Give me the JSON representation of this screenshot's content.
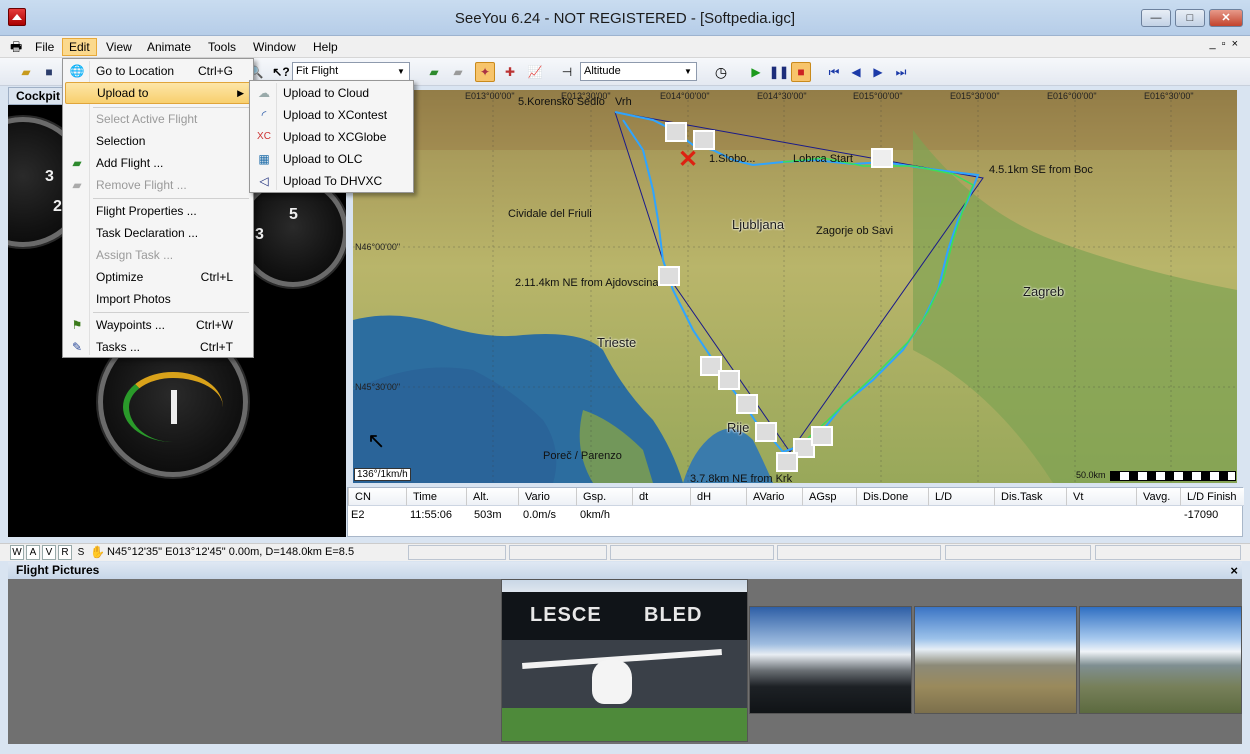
{
  "window": {
    "title": "SeeYou 6.24 - NOT REGISTERED - [Softpedia.igc]",
    "min": "—",
    "max": "□",
    "close": "✕"
  },
  "menubar": [
    "File",
    "Edit",
    "View",
    "Animate",
    "Tools",
    "Window",
    "Help"
  ],
  "mdi": {
    "min": "_",
    "restore": "▫",
    "close": "×"
  },
  "toolbar": {
    "fit_combo": "Fit Flight",
    "altitude_combo": "Altitude"
  },
  "cockpit": {
    "tab": "Cockpit",
    "gauge_numbers": [
      "3",
      "2",
      "3",
      "5"
    ]
  },
  "edit_menu": {
    "items": [
      {
        "label": "Go to Location",
        "shortcut": "Ctrl+G"
      },
      {
        "label": "Upload to",
        "shortcut": ""
      },
      {
        "label": "Select Active Flight",
        "shortcut": ""
      },
      {
        "label": "Selection",
        "shortcut": ""
      },
      {
        "label": "Add Flight ...",
        "shortcut": ""
      },
      {
        "label": "Remove Flight ...",
        "shortcut": ""
      },
      {
        "label": "Flight Properties ...",
        "shortcut": ""
      },
      {
        "label": "Task Declaration ...",
        "shortcut": ""
      },
      {
        "label": "Assign Task ...",
        "shortcut": ""
      },
      {
        "label": "Optimize",
        "shortcut": "Ctrl+L"
      },
      {
        "label": "Import Photos",
        "shortcut": ""
      },
      {
        "label": "Waypoints ...",
        "shortcut": "Ctrl+W"
      },
      {
        "label": "Tasks ...",
        "shortcut": "Ctrl+T"
      }
    ]
  },
  "upload_menu": {
    "items": [
      {
        "label": "Upload to Cloud",
        "icon": "cloud-icon"
      },
      {
        "label": "Upload to XContest",
        "icon": "xcontest-icon"
      },
      {
        "label": "Upload to XCGlobe",
        "icon": "xcglobe-icon"
      },
      {
        "label": "Upload to OLC",
        "icon": "olc-icon"
      },
      {
        "label": "Upload To DHVXC",
        "icon": "dhvxc-icon"
      }
    ]
  },
  "map": {
    "grid_labels": [
      "E013°00'00\"",
      "E013°30'00\"",
      "E014°00'00\"",
      "E014°30'00\"",
      "E015°00'00\"",
      "E015°30'00\"",
      "E016°00'00\"",
      "E016°30'00\"",
      "N46°00'00\"",
      "N45°30'00\""
    ],
    "cities": [
      "Ljubljana",
      "Zagreb",
      "Trieste",
      "Rije",
      "Cividale del Friuli",
      "Zagorje ob Savi",
      "Poreč / Parenzo"
    ],
    "turnpoints": [
      "5.Korensko Sedlo",
      "Vrh",
      "1.Slobo...",
      "Lobrca Start",
      "4.5.1km SE from Boc",
      "2.11.4km NE from Ajdovscina",
      "3.7.8km NE from Krk"
    ],
    "scale_left": "136°/1km/h",
    "scale_right": "50.0km"
  },
  "table": {
    "headers": [
      "CN",
      "Time",
      "Alt.",
      "Vario",
      "Gsp.",
      "dt",
      "dH",
      "AVario",
      "AGsp",
      "Dis.Done",
      "L/D",
      "Dis.Task",
      "Vt",
      "Vavg.",
      "L/D Finish"
    ],
    "row": [
      "E2",
      "11:55:06",
      "503m",
      "0.0m/s",
      "0km/h",
      "",
      "",
      "",
      "",
      "",
      "",
      "",
      "",
      "",
      "-17090"
    ]
  },
  "statusbar": {
    "buttons": [
      "W",
      "A",
      "V",
      "R",
      "S"
    ],
    "coords": "N45°12'35\" E013°12'45\" 0.00m, D=148.0km E=8.5"
  },
  "pictures": {
    "title": "Flight Pictures",
    "close": "×",
    "hangar_sign_1": "LESCE",
    "hangar_sign_2": "BLED"
  },
  "colors": {
    "menu_highlight": "#f8cf6e",
    "accent": "#3a6ea5"
  }
}
